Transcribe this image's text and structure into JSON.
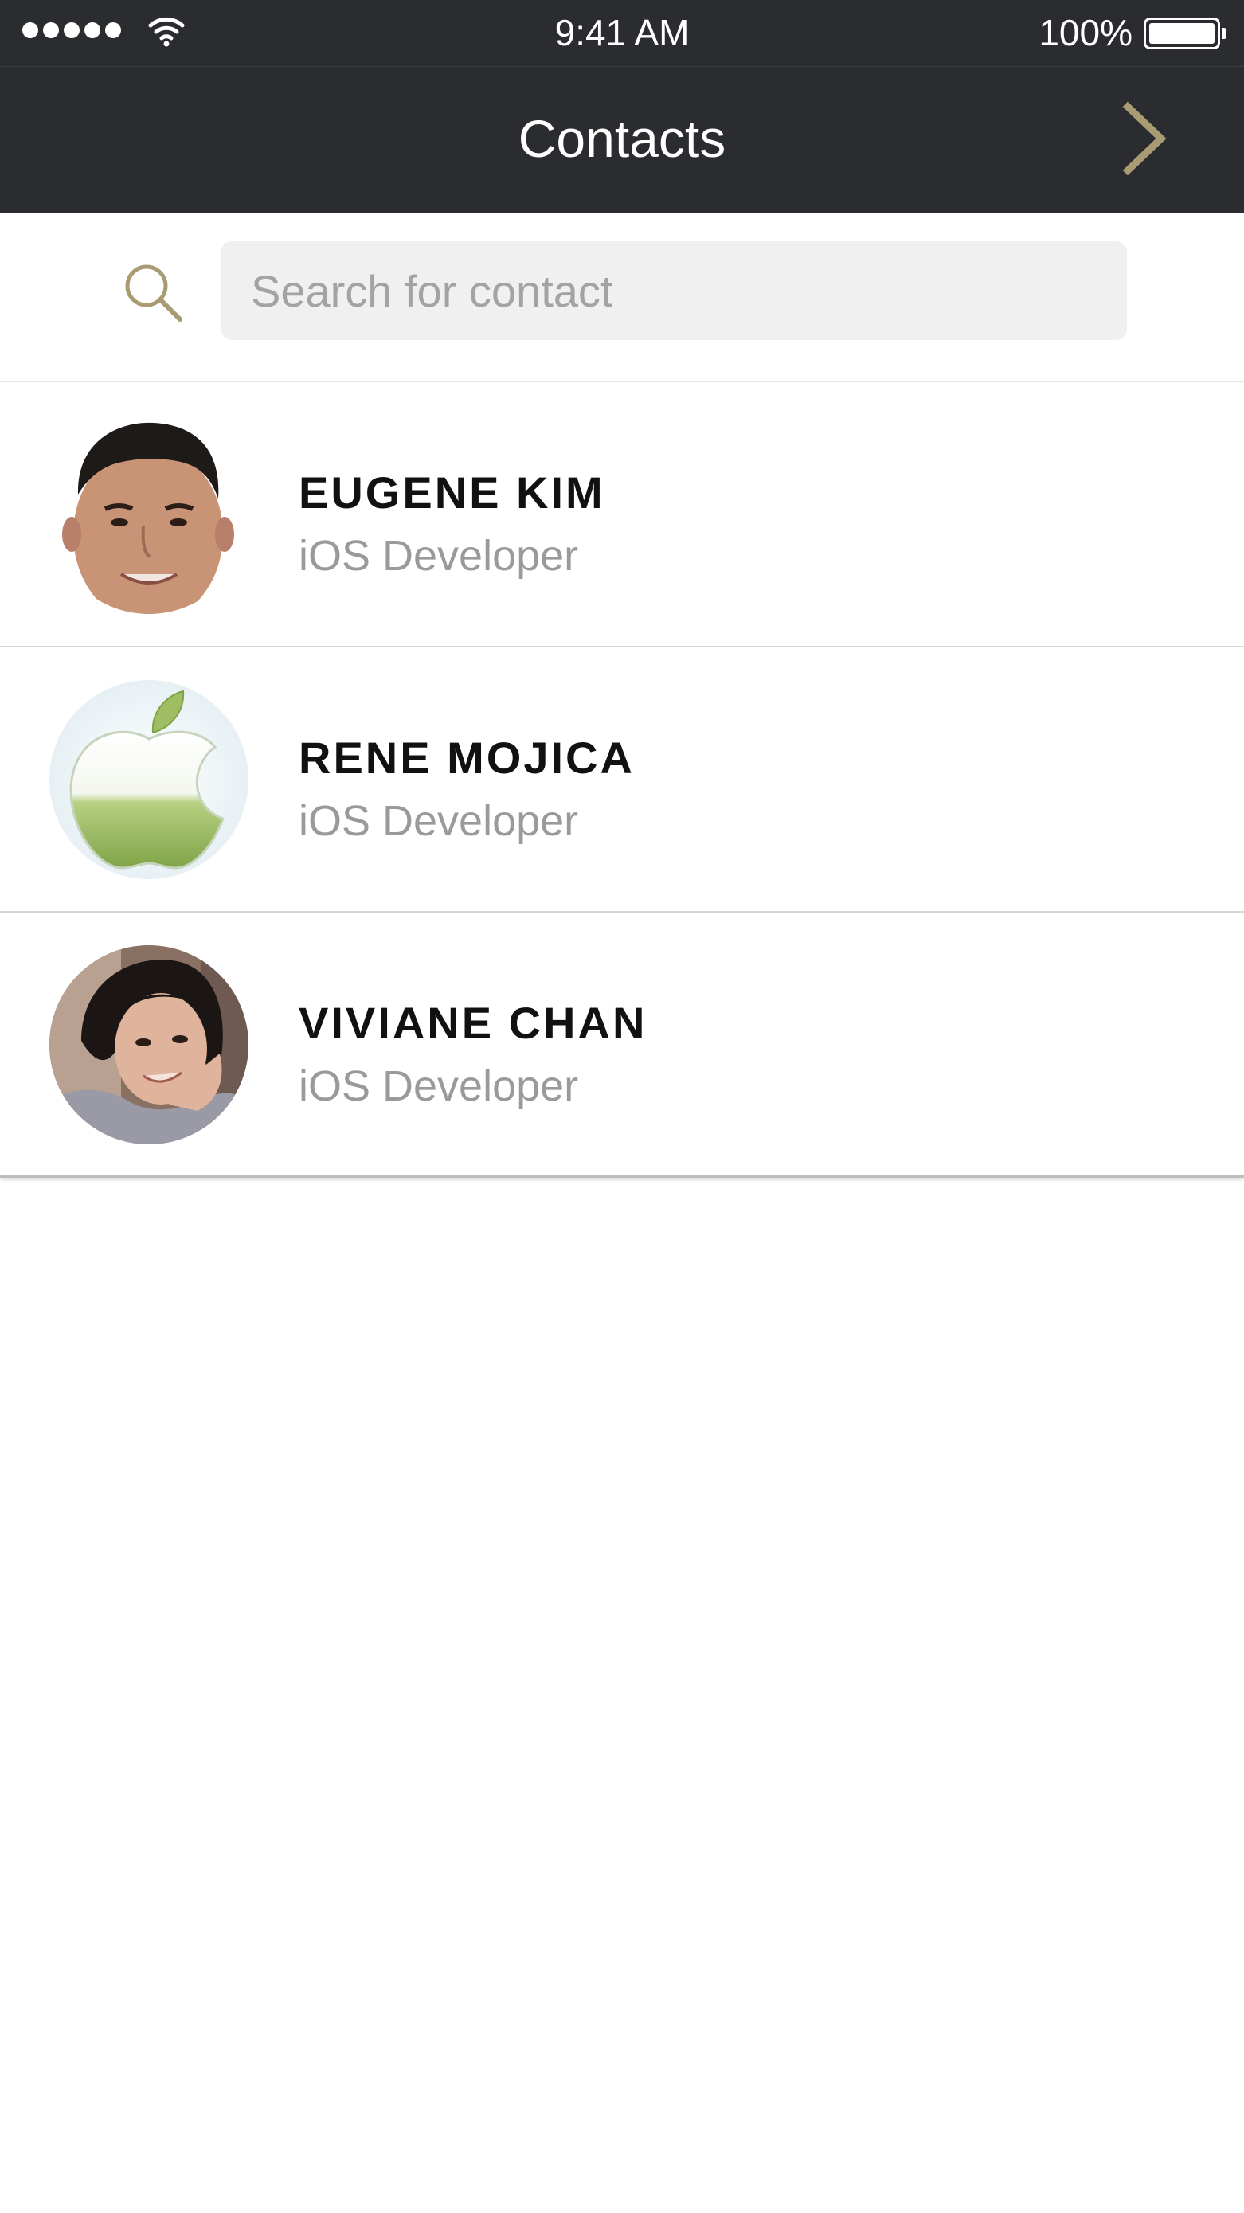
{
  "status_bar": {
    "time": "9:41 AM",
    "battery_percent": "100%",
    "signal_icon": "signal-dots-icon",
    "wifi_icon": "wifi-icon",
    "battery_icon": "battery-full-icon"
  },
  "nav": {
    "title": "Contacts",
    "next_icon": "chevron-right-icon",
    "accent_color": "#a99b72"
  },
  "search": {
    "placeholder": "Search for contact",
    "value": "",
    "icon": "search-icon"
  },
  "contacts": [
    {
      "name": "EUGENE KIM",
      "role": "iOS Developer",
      "avatar": "avatar-photo-man"
    },
    {
      "name": "RENE MOJICA",
      "role": "iOS Developer",
      "avatar": "avatar-apple-logo"
    },
    {
      "name": "VIVIANE CHAN",
      "role": "iOS Developer",
      "avatar": "avatar-photo-woman"
    }
  ],
  "colors": {
    "bar_background": "#2b2c30",
    "name_text": "#111111",
    "role_text": "#9a9a9a",
    "search_field": "#f0f0f0"
  }
}
